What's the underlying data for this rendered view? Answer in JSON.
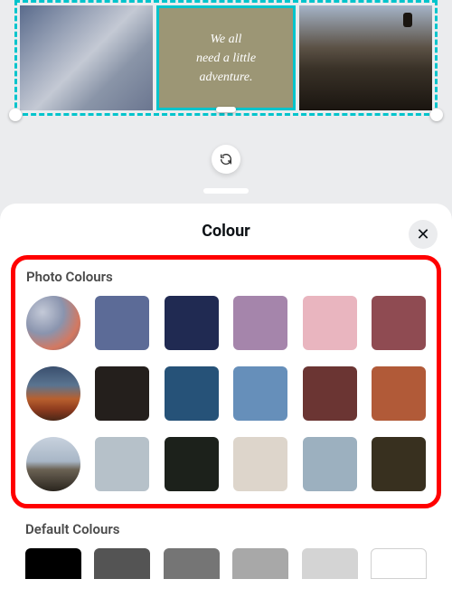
{
  "canvas": {
    "quote_text": "We all\nneed a little\nadventure.",
    "rotate_label": "rotate"
  },
  "panel": {
    "title": "Colour",
    "close_label": "✕"
  },
  "sections": {
    "photo_title": "Photo Colours",
    "default_title": "Default Colours"
  },
  "photo_rows": [
    {
      "thumb": "mountain",
      "colors": [
        "#5c6b97",
        "#202a52",
        "#a585ab",
        "#e9b5bf",
        "#8f4b52"
      ]
    },
    {
      "thumb": "sunset",
      "colors": [
        "#241f1c",
        "#265278",
        "#668fba",
        "#6b3533",
        "#b15a38"
      ]
    },
    {
      "thumb": "hiker",
      "colors": [
        "#b6c1c9",
        "#1c211b",
        "#ddd5cb",
        "#9cb0bf",
        "#38301f"
      ]
    }
  ],
  "default_colors": [
    "#000000",
    "#545454",
    "#757575",
    "#a8a8a8",
    "#d4d4d4",
    "#ffffff"
  ]
}
